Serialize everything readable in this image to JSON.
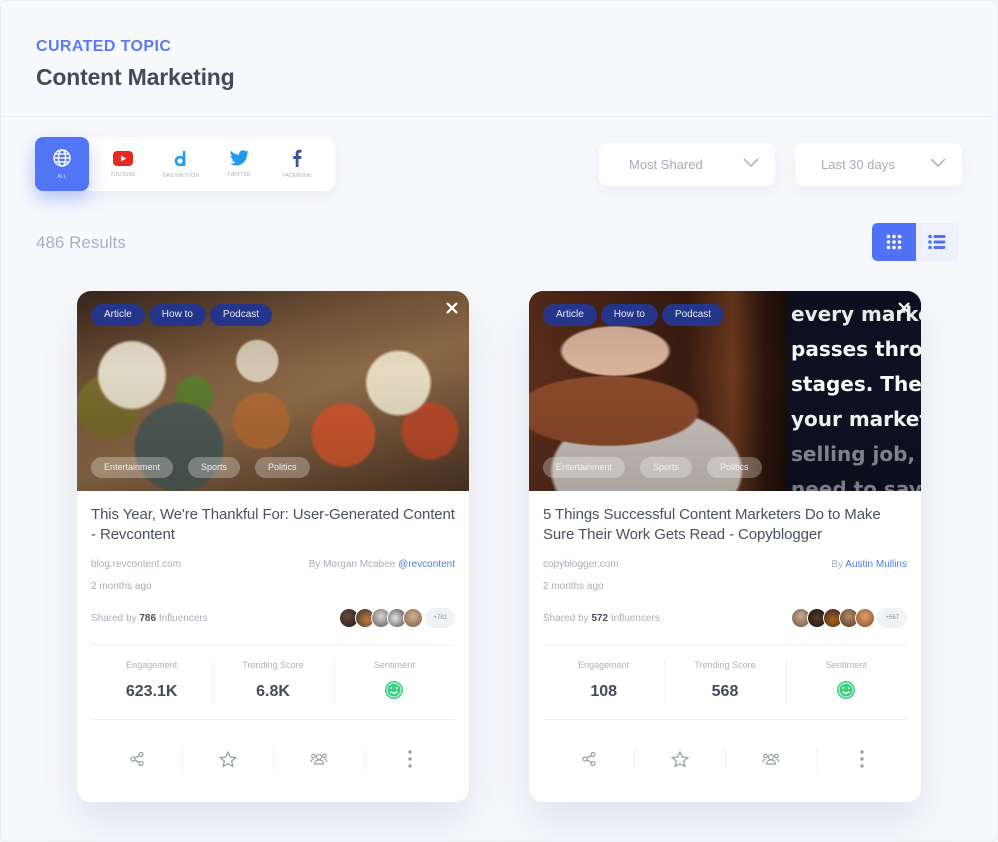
{
  "header": {
    "eyebrow": "CURATED TOPIC",
    "title": "Content Marketing"
  },
  "sources": [
    {
      "id": "all",
      "label": "All",
      "icon": "globe-icon",
      "active": true
    },
    {
      "id": "youtube",
      "label": "Youtube",
      "icon": "youtube-icon",
      "active": false
    },
    {
      "id": "dailymotion",
      "label": "Dailymotion",
      "icon": "dailymotion-icon",
      "active": false
    },
    {
      "id": "twitter",
      "label": "Twitter",
      "icon": "twitter-icon",
      "active": false
    },
    {
      "id": "facebook",
      "label": "Facebook",
      "icon": "facebook-icon",
      "active": false
    }
  ],
  "filters": {
    "sort": {
      "value": "Most Shared"
    },
    "range": {
      "value": "Last 30 days"
    }
  },
  "results_label": "486 Results",
  "view_mode": "grid",
  "colors": {
    "accent": "#5275f5",
    "tag_dark": "#25368a",
    "positive": "#3ccf82",
    "link": "#4d7bf3"
  },
  "cards": [
    {
      "tags_top": [
        "Article",
        "How to",
        "Podcast"
      ],
      "tags_bottom": [
        "Entertainment",
        "Sports",
        "Politics"
      ],
      "title": "This Year, We're Thankful For: User-Generated Content - Revcontent",
      "domain": "blog.revcontent.com",
      "author_prefix": "By Morgan Mcabee ",
      "author_link": "@revcontent",
      "time": "2 months ago",
      "shared_prefix": "Shared by ",
      "shared_count": "786",
      "shared_suffix": " Influencers",
      "more_influencers": "+781",
      "stats": {
        "engagement_label": "Engagement",
        "engagement": "623.1K",
        "trending_label": "Trending Score",
        "trending": "6.8K",
        "sentiment_label": "Sentiment",
        "sentiment": "positive"
      }
    },
    {
      "tags_top": [
        "Article",
        "How to",
        "Podcast"
      ],
      "tags_bottom": [
        "Entertainment",
        "Sports",
        "Politics"
      ],
      "image_text": [
        "every marke",
        "passes thro",
        "stages. The",
        "your market",
        "selling job, ",
        "need to say"
      ],
      "title": "5 Things Successful Content Marketers Do to Make Sure Their Work Gets Read - Copyblogger",
      "domain": "copyblogger.com",
      "author_prefix": "By ",
      "author_link": "Austin Mullins",
      "time": "2 months ago",
      "shared_prefix": "Shared by ",
      "shared_count": "572",
      "shared_suffix": " Influencers",
      "more_influencers": "+567",
      "stats": {
        "engagement_label": "Engagement",
        "engagement": "108",
        "trending_label": "Trending Score",
        "trending": "568",
        "sentiment_label": "Sentiment",
        "sentiment": "positive"
      }
    }
  ]
}
